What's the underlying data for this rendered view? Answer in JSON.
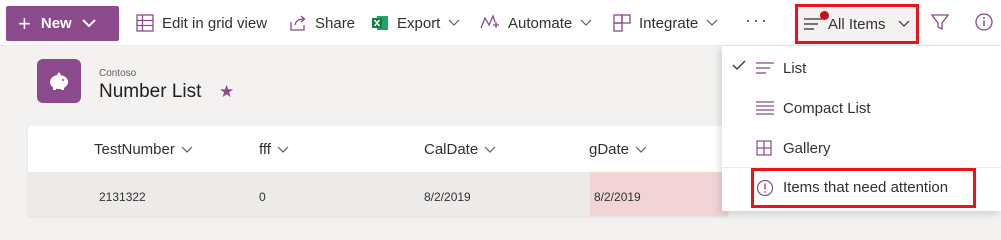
{
  "commandbar": {
    "new_label": "New",
    "edit_grid_label": "Edit in grid view",
    "share_label": "Share",
    "export_label": "Export",
    "automate_label": "Automate",
    "integrate_label": "Integrate",
    "more_label": "···",
    "view_label": "All Items"
  },
  "header": {
    "site_name": "Contoso",
    "list_title": "Number List",
    "star": "★"
  },
  "grid": {
    "columns": [
      "TestNumber",
      "fff",
      "CalDate",
      "gDate"
    ],
    "rows": [
      [
        "2131322",
        "0",
        "8/2/2019",
        "8/2/2019"
      ]
    ]
  },
  "view_menu": {
    "items": [
      {
        "label": "List",
        "icon": "list-icon",
        "selected": true
      },
      {
        "label": "Compact List",
        "icon": "compact-list-icon",
        "selected": false
      },
      {
        "label": "Gallery",
        "icon": "gallery-icon",
        "selected": false
      },
      {
        "label": "Items that need attention",
        "icon": "alert-circle-icon",
        "selected": false
      }
    ]
  },
  "colors": {
    "brand": "#8a4a8c",
    "highlight_border": "#e8141a",
    "excel_green": "#107c41",
    "attention_cell": "#f2d4d7"
  }
}
